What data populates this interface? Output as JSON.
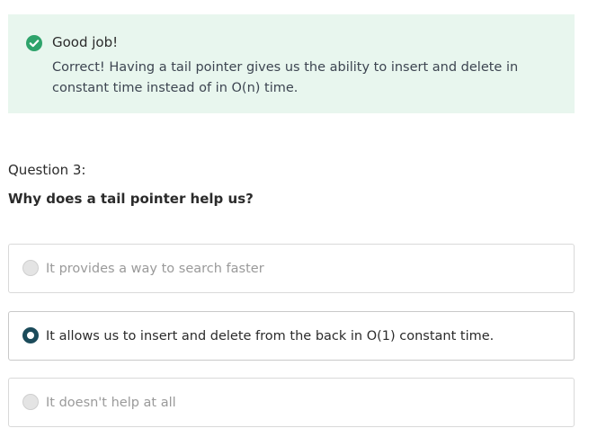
{
  "feedback": {
    "icon": "check-circle-icon",
    "status_color": "#2ea36b",
    "title": "Good job!",
    "message": "Correct! Having a tail pointer gives us the ability to insert and delete in constant time instead of in O(n) time."
  },
  "question": {
    "number_label": "Question 3:",
    "text": "Why does a tail pointer help us?",
    "options": [
      {
        "label": "It provides a way to search faster",
        "selected": false
      },
      {
        "label": "It allows us to insert and delete from the back in O(1) constant time.",
        "selected": true
      },
      {
        "label": "It doesn't help at all",
        "selected": false
      }
    ]
  },
  "colors": {
    "feedback_background": "#e8f6ee",
    "selected_radio": "#1b4b5a"
  }
}
